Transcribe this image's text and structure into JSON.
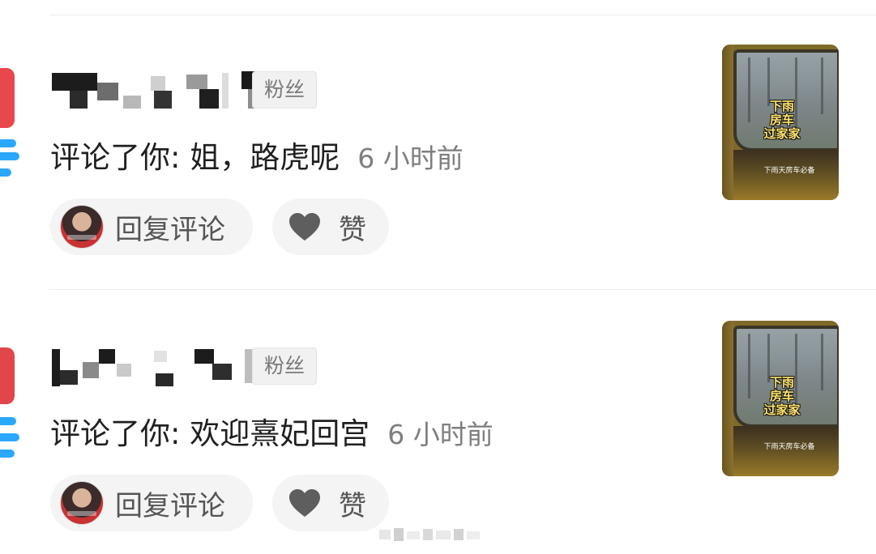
{
  "notifications": [
    {
      "username": "",
      "badge": "粉丝",
      "action": "评论了你: ",
      "comment": "姐，路虎呢",
      "time": "6 小时前",
      "reply_label": "回复评论",
      "like_label": "赞",
      "thumbnail": {
        "title_lines": [
          "下雨",
          "房车",
          "过家家"
        ],
        "subtitle": "下雨天房车必备"
      }
    },
    {
      "username": "",
      "badge": "粉丝",
      "action": "评论了你: ",
      "comment": "欢迎熹妃回宫",
      "time": "6 小时前",
      "reply_label": "回复评论",
      "like_label": "赞",
      "thumbnail": {
        "title_lines": [
          "下雨",
          "房车",
          "过家家"
        ],
        "subtitle": "下雨天房车必备"
      }
    }
  ],
  "colors": {
    "text_primary": "#1f1f1f",
    "text_secondary": "#7e7e7e",
    "button_bg": "#f4f4f4",
    "badge_bg": "#f1f1f1",
    "heart": "#5e5e5e",
    "avatar_red": "#e8474b",
    "avatar_blue": "#2aa7ff"
  },
  "icons": [
    "heart-icon",
    "avatar",
    "video-thumbnail"
  ]
}
